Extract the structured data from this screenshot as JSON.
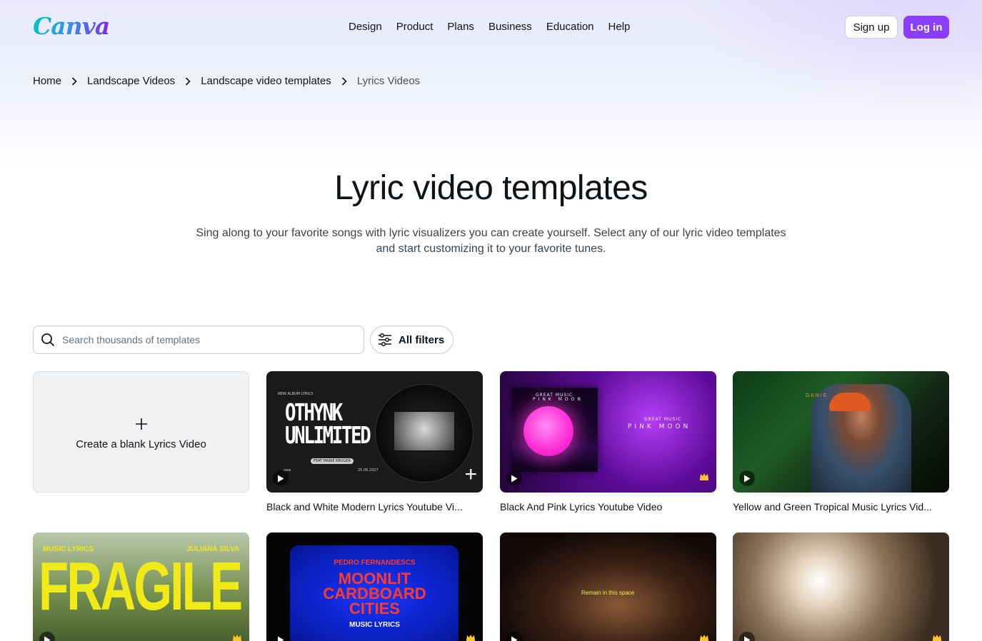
{
  "brand": {
    "logo_text": "Canva"
  },
  "nav": {
    "items": [
      "Design",
      "Product",
      "Plans",
      "Business",
      "Education",
      "Help"
    ],
    "signup_label": "Sign up",
    "login_label": "Log in"
  },
  "breadcrumb": {
    "items": [
      "Home",
      "Landscape Videos",
      "Landscape video templates"
    ],
    "current": "Lyrics Videos"
  },
  "page": {
    "title": "Lyric video templates",
    "subtitle": "Sing along to your favorite songs with lyric visualizers you can create yourself. Select any of our lyric video templates and start customizing it to your favorite tunes."
  },
  "search": {
    "placeholder": "Search thousands of templates",
    "value": ""
  },
  "filters": {
    "label": "All filters"
  },
  "blank_card": {
    "label": "Create a blank Lyrics Video"
  },
  "templates": [
    {
      "caption": "Black and White Modern Lyrics Youtube Vi...",
      "art_text": [
        "OTHYNK",
        "UNLIMITED",
        "NEW ALBUM LYRICS",
        "25.06.2027",
        "new",
        "FEAT MARIE KRUGER"
      ],
      "premium": false
    },
    {
      "caption": "Black And Pink Lyrics Youtube Video",
      "art_text": [
        "PINK MOON",
        "GREAT MUSIC",
        "PINK MOON",
        "GREAT MUSIC"
      ],
      "premium": true
    },
    {
      "caption": "Yellow and Green Tropical Music Lyrics Vid...",
      "art_text": [
        "DANIE"
      ],
      "premium": false
    },
    {
      "caption": "",
      "art_text": [
        "MUSIC LYRICS",
        "JULIANA SILVA",
        "FRAGILE"
      ],
      "premium": true
    },
    {
      "caption": "",
      "art_text": [
        "PEDRO FERNANDESCS",
        "MOONLIT",
        "CARDBOARD",
        "CITIES",
        "MUSIC LYRICS"
      ],
      "premium": true
    },
    {
      "caption": "",
      "art_text": [
        "Remain in this space"
      ],
      "premium": true
    },
    {
      "caption": "",
      "art_text": [],
      "premium": true
    }
  ],
  "colors": {
    "brand_purple": "#8b3dff",
    "text_primary": "#0e1318",
    "crown_gold": "#ffc62a"
  },
  "icons": [
    "search-icon",
    "filters-icon",
    "chevron-right-icon",
    "play-icon",
    "crown-icon",
    "plus-icon"
  ]
}
